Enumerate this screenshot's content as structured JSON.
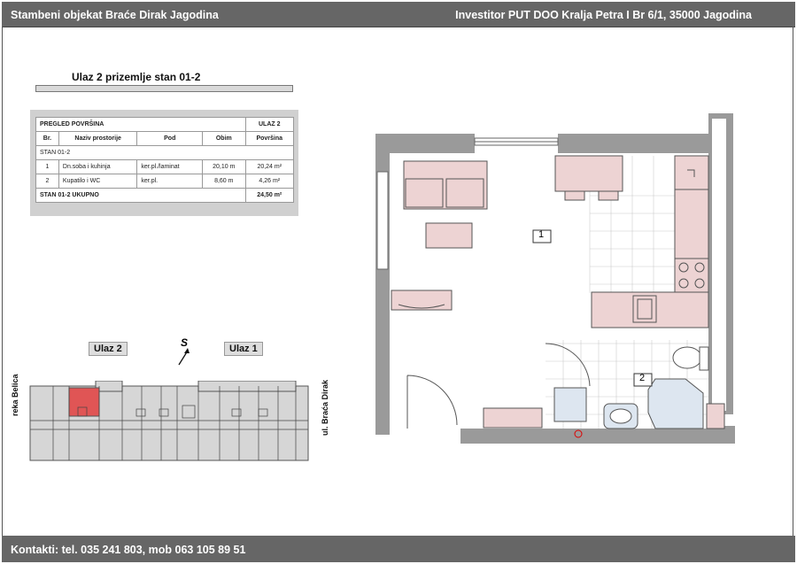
{
  "header": {
    "left": "Stambeni objekat Braće Dirak  Jagodina",
    "right": "Investitor PUT DOO Kralja Petra I Br 6/1, 35000 Jagodina"
  },
  "footer": {
    "contact": "Kontakti: tel. 035 241 803, mob 063 105 89 51"
  },
  "unit_title": "Ulaz 2 prizemlje stan 01-2",
  "table": {
    "title": "PREGLED POVRŠINA",
    "entrance": "ULAZ 2",
    "columns": [
      "Br.",
      "Naziv prostorije",
      "Pod",
      "Obim",
      "Površina"
    ],
    "group": "STAN 01-2",
    "rows": [
      {
        "no": "1",
        "name": "Dn.soba i kuhinja",
        "floor": "ker.pl./laminat",
        "perimeter": "20,10 m",
        "area": "20,24 m²"
      },
      {
        "no": "2",
        "name": "Kupatilo i WC",
        "floor": "ker.pl.",
        "perimeter": "8,60 m",
        "area": "4,26 m²"
      }
    ],
    "total_label": "STAN 01-2  UKUPNO",
    "total_value": "24,50 m²"
  },
  "site_plan": {
    "entrance_2": "Ulaz 2",
    "entrance_1": "Ulaz 1",
    "compass": "S",
    "river": "reka Belica",
    "street": "ul. Braća Dirak",
    "highlight_color": "#e05555"
  },
  "floor_plan": {
    "room_1": "1",
    "room_2": "2",
    "furniture_color": "#edd3d3",
    "wall_color": "#9a9a9a"
  }
}
